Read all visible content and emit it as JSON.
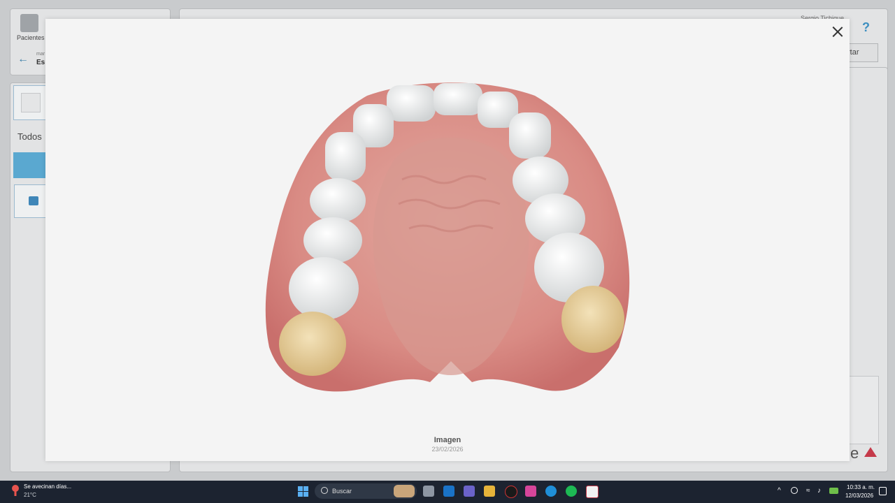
{
  "app": {
    "nav_label": "Pacientes",
    "breadcrumb_small": "mar",
    "breadcrumb_main": "Es",
    "user_name": "Sergio Tichique",
    "export_label": "rtar",
    "filter_label": "Todos",
    "brand_text": "e"
  },
  "modal": {
    "image_title": "Imagen",
    "image_date": "23/02/2026"
  },
  "taskbar": {
    "weather_text": "Se avecinan días...",
    "weather_temp": "21°C",
    "search_placeholder": "Buscar",
    "time": "10:33 a. m.",
    "date": "12/03/2026"
  },
  "colors": {
    "accent": "#5aa8d0",
    "taskbar_bg": "#1c2330",
    "modal_bg": "#f4f4f4"
  }
}
